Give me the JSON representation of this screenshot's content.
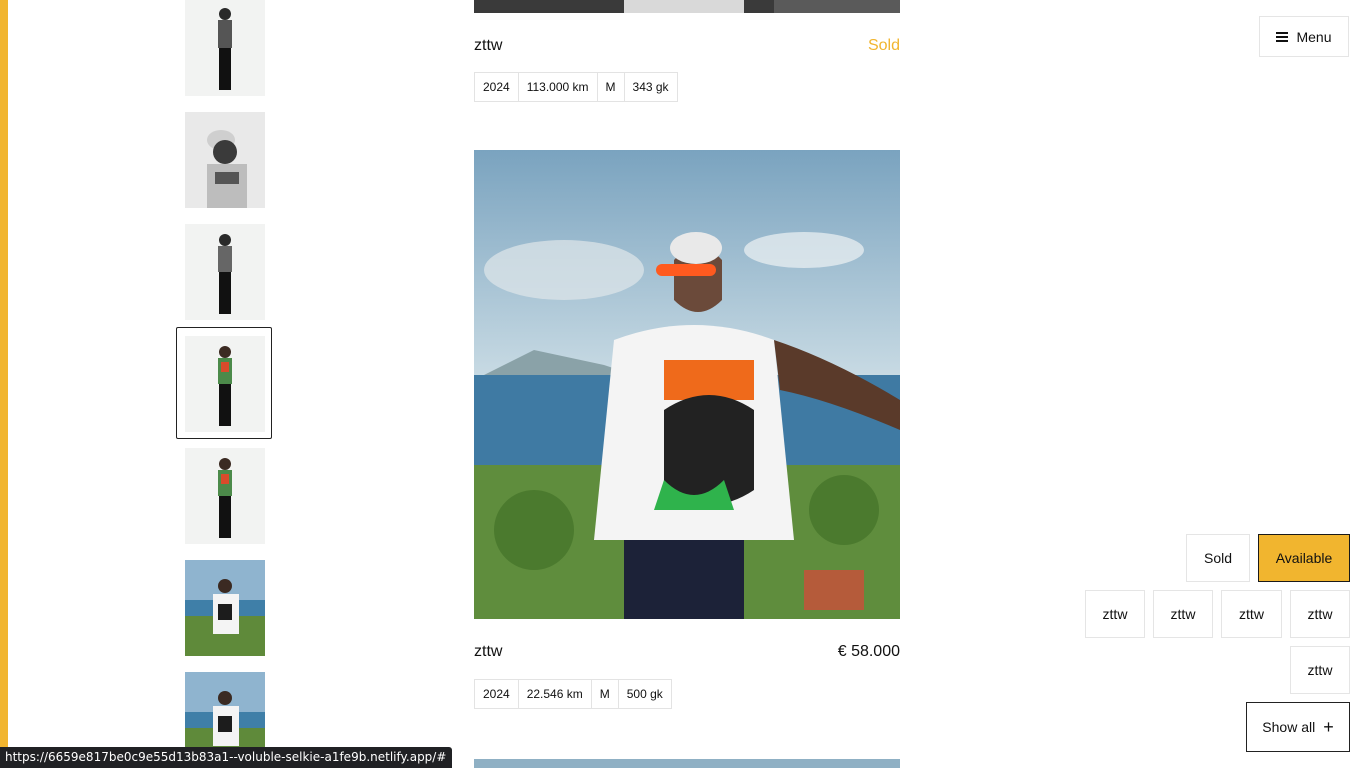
{
  "colors": {
    "accent": "#f1b52f",
    "text": "#111111",
    "border": "#e3e3e3"
  },
  "menu": {
    "label": "Menu",
    "icon": "hamburger-icon"
  },
  "thumbnails": [
    {
      "alt": "thumbnail-1",
      "selected": false
    },
    {
      "alt": "thumbnail-2",
      "selected": false
    },
    {
      "alt": "thumbnail-3",
      "selected": false
    },
    {
      "alt": "thumbnail-4",
      "selected": true
    },
    {
      "alt": "thumbnail-5",
      "selected": false
    },
    {
      "alt": "thumbnail-6",
      "selected": false
    },
    {
      "alt": "thumbnail-7",
      "selected": false
    }
  ],
  "listings": [
    {
      "title": "zttw",
      "status": "Sold",
      "specs": [
        "2024",
        "113.000 km",
        "M",
        "343 gk"
      ]
    },
    {
      "title": "zttw",
      "status": "€ 58.000",
      "specs": [
        "2024",
        "22.546 km",
        "M",
        "500 gk"
      ]
    }
  ],
  "filters": {
    "status": [
      {
        "label": "Sold",
        "active": false
      },
      {
        "label": "Available",
        "active": true
      }
    ],
    "brands": [
      "zttw",
      "zttw",
      "zttw",
      "zttw",
      "zttw"
    ],
    "show_all": "Show all"
  },
  "status_url": "https://6659e817be0c9e55d13b83a1--voluble-selkie-a1fe9b.netlify.app/#"
}
